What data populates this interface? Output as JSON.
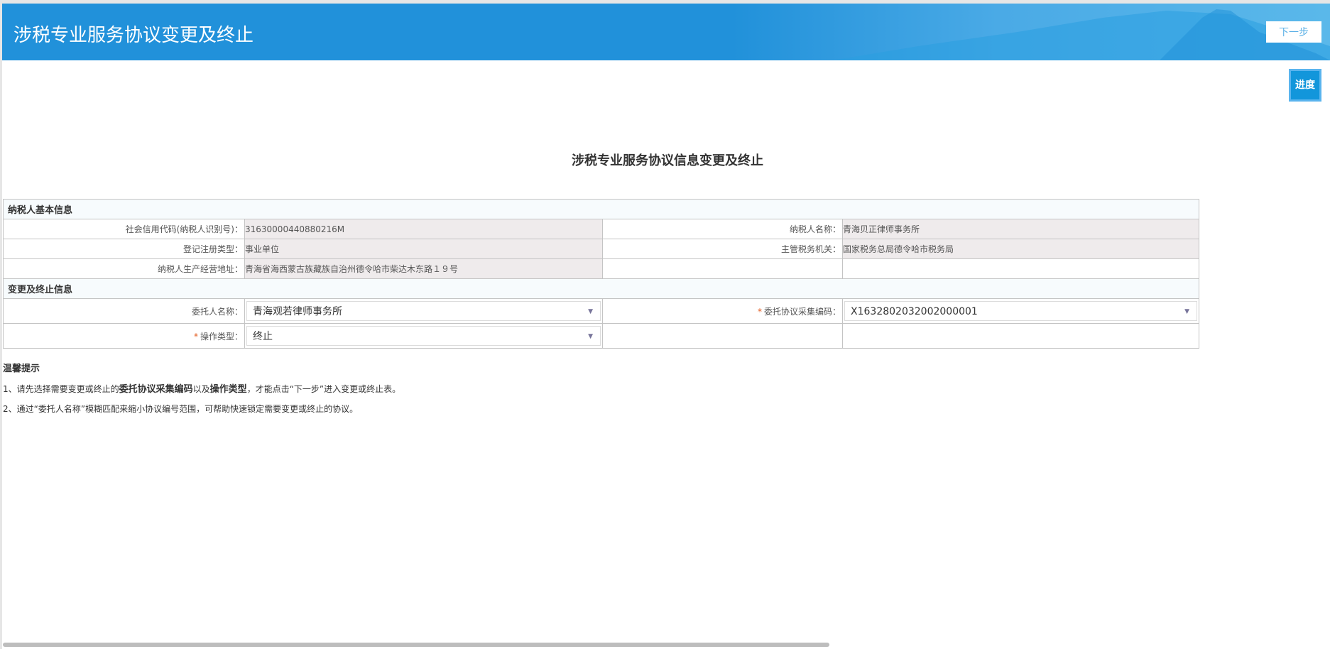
{
  "header": {
    "title": "涉税专业服务协议变更及终止",
    "next_label": "下一步"
  },
  "progress_label": "进度",
  "page_title": "涉税专业服务协议信息变更及终止",
  "basic": {
    "section_title": "纳税人基本信息",
    "credit_code_label": "社会信用代码(纳税人识别号)：",
    "credit_code": "31630000440880216M",
    "name_label": "纳税人名称：",
    "name": "青海贝正律师事务所",
    "reg_type_label": "登记注册类型：",
    "reg_type": "事业单位",
    "tax_office_label": "主管税务机关：",
    "tax_office": "国家税务总局德令哈市税务局",
    "address_label": "纳税人生产经营地址：",
    "address": "青海省海西蒙古族藏族自治州德令哈市柴达木东路１９号"
  },
  "change": {
    "section_title": "变更及终止信息",
    "client_label": "委托人名称：",
    "client_value": "青海观若律师事务所",
    "code_label": "委托协议采集编码：",
    "code_value": "X1632802032002000001",
    "op_label": "操作类型：",
    "op_value": "终止",
    "required_mark": "*"
  },
  "tips": {
    "title": "温馨提示",
    "t1_a": "1、请先选择需要变更或终止的",
    "t1_b": "委托协议采集编码",
    "t1_c": "以及",
    "t1_d": "操作类型",
    "t1_e": "，才能点击“下一步”进入变更或终止表。",
    "t2": "2、通过“委托人名称”模糊匹配来缩小协议编号范围，可帮助快速锁定需要变更或终止的协议。"
  }
}
